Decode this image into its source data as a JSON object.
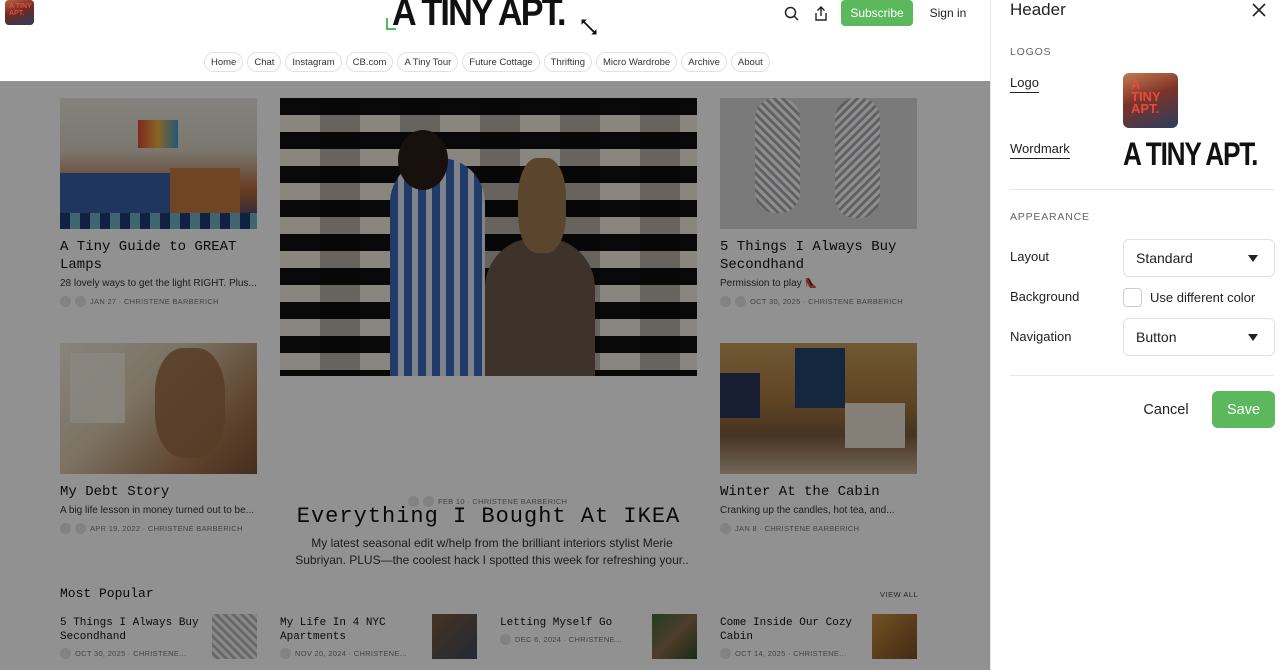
{
  "site": {
    "wordmark": "A TINY APT.",
    "logo_thumb_text": "A TINY APT.",
    "subscribe_label": "Subscribe",
    "signin_label": "Sign in",
    "nav": [
      "Home",
      "Chat",
      "Instagram",
      "CB.com",
      "A Tiny Tour",
      "Future Cottage",
      "Thrifting",
      "Micro Wardrobe",
      "Archive",
      "About"
    ],
    "posts": {
      "lamps": {
        "title": "A Tiny Guide to GREAT Lamps",
        "subtitle": "28 lovely ways to get the light RIGHT. Plus...",
        "meta": "JAN 27 · CHRISTENE BARBERICH"
      },
      "secondhand": {
        "title": "5 Things I Always Buy Secondhand",
        "subtitle": "Permission to play 👠",
        "meta": "OCT 30, 2025 · CHRISTENE BARBERICH"
      },
      "debt": {
        "title": "My Debt Story",
        "subtitle": "A big life lesson in money turned out to be...",
        "meta": "APR 19, 2022 · CHRISTENE BARBERICH"
      },
      "cabin": {
        "title": "Winter At the Cabin",
        "subtitle": "Cranking up the candles, hot tea, and...",
        "meta": "JAN 8 · CHRISTENE BARBERICH"
      },
      "ikea": {
        "title": "Everything I Bought At IKEA",
        "subtitle": "My latest seasonal edit w/help from the brilliant interiors stylist Merie Subriyan. PLUS—the coolest hack I spotted this week for refreshing your..",
        "meta": "FEB 10 · CHRISTENE BARBERICH"
      }
    },
    "popular": {
      "heading": "Most Popular",
      "view_all": "VIEW ALL",
      "items": [
        {
          "title": "5 Things I Always Buy Secondhand",
          "meta": "OCT 30, 2025 · CHRISTENE..."
        },
        {
          "title": "My Life In 4 NYC Apartments",
          "meta": "NOV 20, 2024 · CHRISTENE..."
        },
        {
          "title": "Letting Myself Go",
          "meta": "DEC 6, 2024 · CHRISTENE..."
        },
        {
          "title": "Come Inside Our Cozy Cabin",
          "meta": "OCT 14, 2025 · CHRISTENE..."
        }
      ]
    }
  },
  "panel": {
    "title": "Header",
    "logos_section": "LOGOS",
    "logo_label": "Logo",
    "wordmark_label": "Wordmark",
    "wordmark_preview": "A TINY APT.",
    "appearance_section": "APPEARANCE",
    "layout_label": "Layout",
    "layout_value": "Standard",
    "background_label": "Background",
    "background_option": "Use different color",
    "navigation_label": "Navigation",
    "navigation_value": "Button",
    "cancel_label": "Cancel",
    "save_label": "Save"
  },
  "colors": {
    "accent": "#5cb85c",
    "overlay": "rgba(0,0,0,0.43)"
  }
}
